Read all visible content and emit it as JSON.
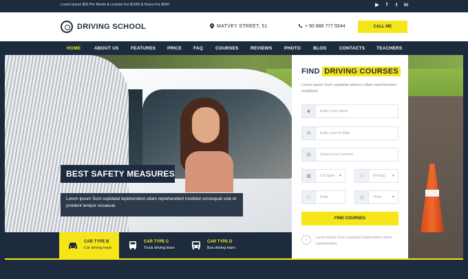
{
  "topbar": {
    "promo": "Lorem Ipsum $20 Per Month & License For $1250 & Hours For $600",
    "social": [
      "youtube-icon",
      "facebook-icon",
      "twitter-icon",
      "linkedin-icon"
    ]
  },
  "header": {
    "logo_text": "DRIVING SCHOOL",
    "address": "MATVEY STREET, 51",
    "phone": "+ 90 888 777 5544",
    "call_label": "CALL ME"
  },
  "nav": {
    "items": [
      "HOME",
      "ABOUT US",
      "FEATURES",
      "PRICE",
      "FAQ",
      "COURSES",
      "REVIEWS",
      "PHOTO",
      "BLOG",
      "CONTACTS",
      "TEACHERS"
    ],
    "active": "HOME"
  },
  "hero": {
    "caption_title": "BEST SAFETY MEASURES",
    "caption_text": "Lorem ipsum Sunt cupidatat tepidrendent ullam reprehendent incididut consequat sole et proident tempor occaecat."
  },
  "car_types": [
    {
      "title": "CAR TYPE B",
      "subtitle": "Car driving learn",
      "icon": "car-icon",
      "selected": true
    },
    {
      "title": "CAR TYPE C",
      "subtitle": "Truck driving learn",
      "icon": "truck-icon",
      "selected": false
    },
    {
      "title": "CAR TYPE D",
      "subtitle": "Bus driving learn",
      "icon": "bus-icon",
      "selected": false
    }
  ],
  "finder": {
    "title_prefix": "FIND",
    "title_highlight": "DRIVING COURSES",
    "description": "Lorem ipsum Sunt cupidatat ullamco ullam reprehendent incididunt.",
    "name_placeholder": "Enter your name",
    "email_placeholder": "Enter your E-Mail",
    "license_placeholder": "Select your License",
    "car_type_placeholder": "Car type",
    "driving_placeholder": "Driving",
    "date_placeholder": "Date",
    "time_placeholder": "Time",
    "button_label": "FIND COURSES",
    "note": "Lorem ipsum Sunt cupidatat tepidrendent ullam reprehendent"
  },
  "colors": {
    "accent": "#f6e619",
    "navy": "#1c2b3e"
  }
}
